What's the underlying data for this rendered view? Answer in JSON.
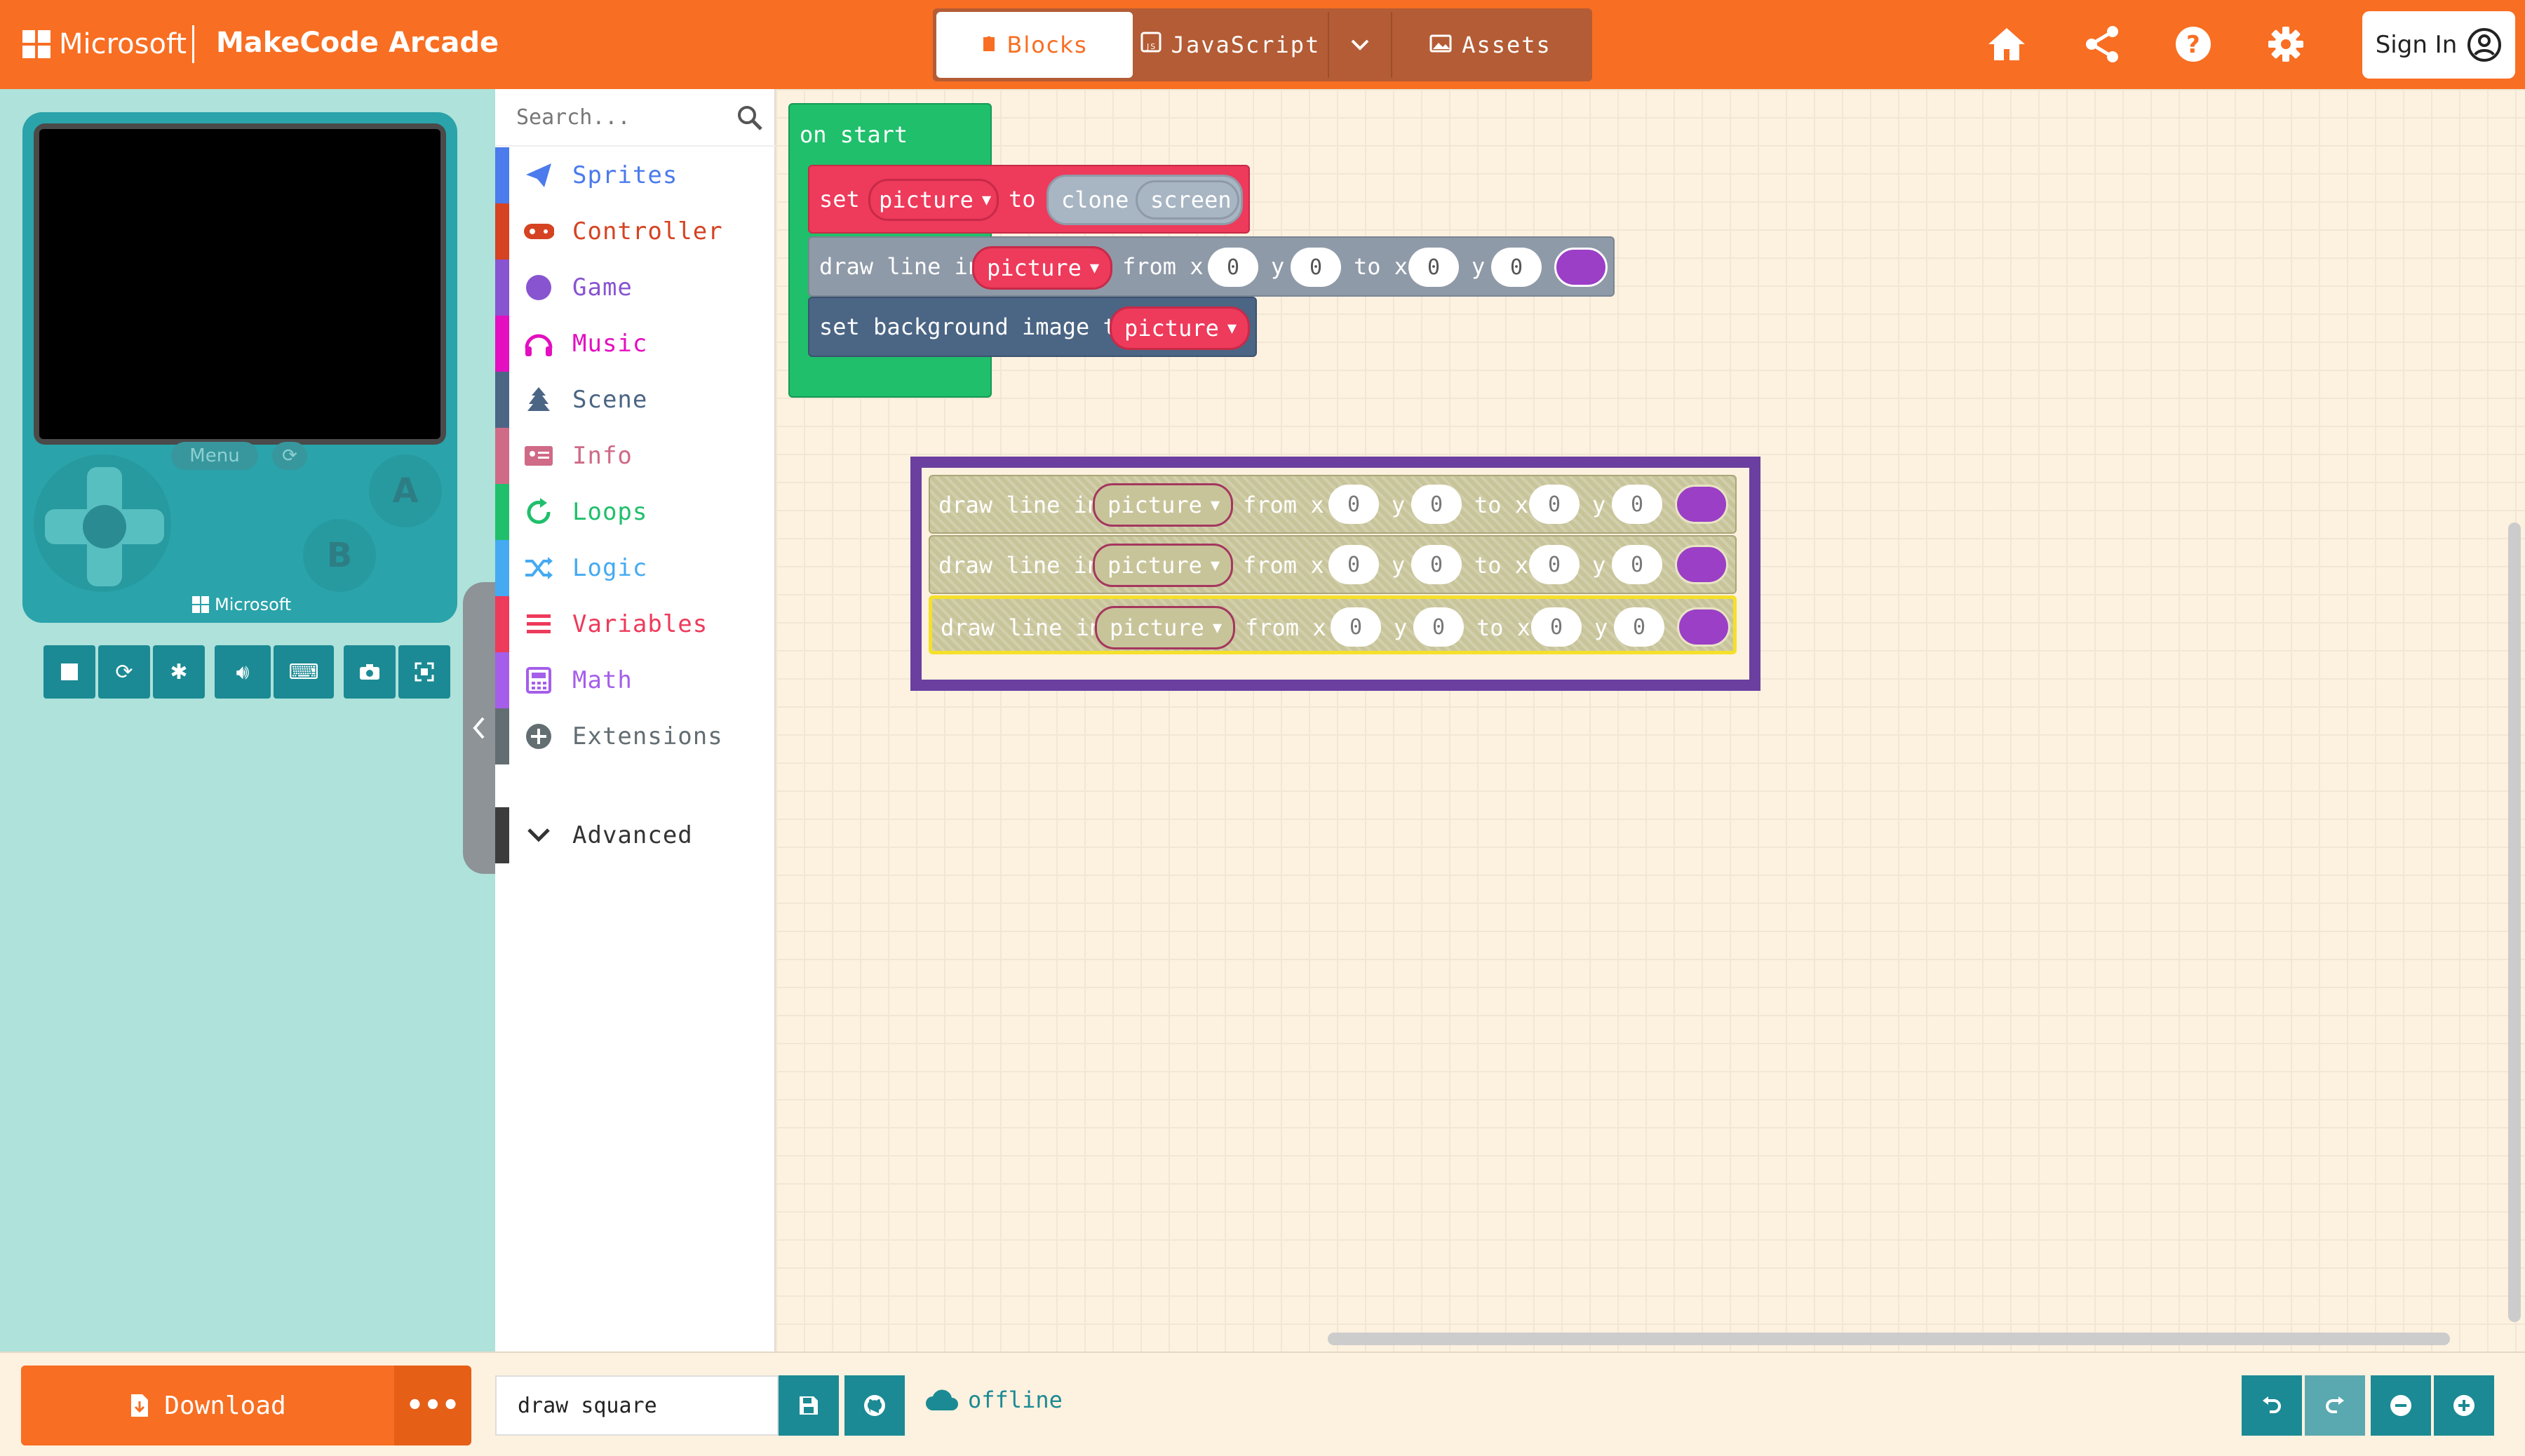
{
  "header": {
    "brand": "Microsoft",
    "app_title": "MakeCode Arcade",
    "tabs": {
      "blocks": "Blocks",
      "javascript": "JavaScript",
      "assets": "Assets"
    },
    "sign_in": "Sign In",
    "icons": [
      "home-icon",
      "share-icon",
      "help-icon",
      "settings-icon"
    ]
  },
  "simulator": {
    "menu_label": "Menu",
    "button_a": "A",
    "button_b": "B",
    "device_brand": "Microsoft",
    "toolbar": [
      "stop-icon",
      "restart-icon",
      "debug-icon",
      "sound-icon",
      "keyboard-icon",
      "screenshot-icon",
      "fullscreen-icon"
    ]
  },
  "toolbox": {
    "search_placeholder": "Search...",
    "categories": [
      {
        "label": "Sprites",
        "color": "#4b7bec"
      },
      {
        "label": "Controller",
        "color": "#d54322"
      },
      {
        "label": "Game",
        "color": "#8854d0"
      },
      {
        "label": "Music",
        "color": "#e30fc0"
      },
      {
        "label": "Scene",
        "color": "#4b6584"
      },
      {
        "label": "Info",
        "color": "#cf6a87"
      },
      {
        "label": "Loops",
        "color": "#20bf6b"
      },
      {
        "label": "Logic",
        "color": "#45aaf2"
      },
      {
        "label": "Variables",
        "color": "#ee3a5b"
      },
      {
        "label": "Math",
        "color": "#a55eea"
      },
      {
        "label": "Extensions",
        "color": "#636e72"
      }
    ],
    "advanced": "Advanced"
  },
  "blocks": {
    "on_start": "on start",
    "set": "set",
    "var": "picture",
    "to": "to",
    "clone": "clone",
    "screen": "screen",
    "draw_line_in": "draw line in",
    "from_x": "from x",
    "y": "y",
    "to_x": "to x",
    "zero": "0",
    "set_bg": "set background image to"
  },
  "footer": {
    "download": "Download",
    "more": "•••",
    "project_name": "draw square",
    "status": "offline"
  },
  "colors": {
    "brand": "#f86e22",
    "teal": "#1b8a94",
    "images": "#a4375e",
    "images_red": "#e8344f",
    "loops": "#20bf6b",
    "scene": "#4b6584",
    "lines": "#8f9aa8",
    "color": "#9b3fc6"
  }
}
